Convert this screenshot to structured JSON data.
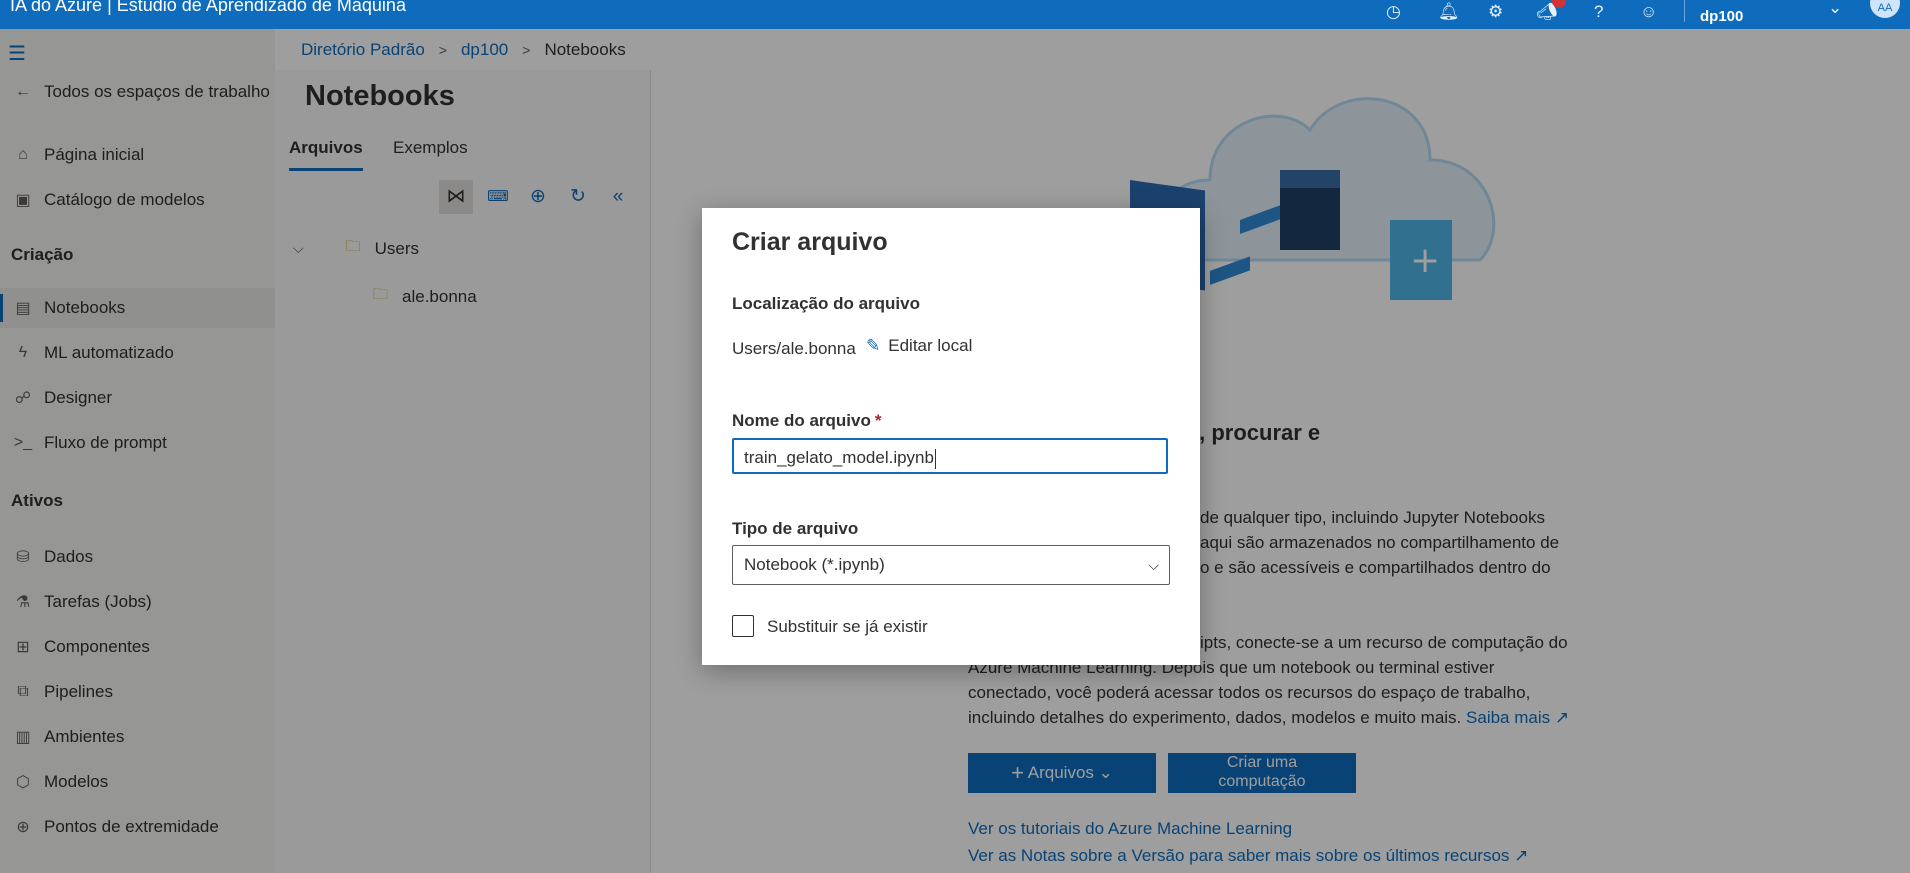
{
  "app": {
    "title": "IA do Azure | Estúdio de Aprendizado de Máquina",
    "account": "dp100",
    "avatar": "AA"
  },
  "breadcrumb": [
    "Diretório Padrão",
    "dp100",
    "Notebooks"
  ],
  "sidebar": {
    "back_label": "Todos os espaços de trabalho",
    "items_top": [
      {
        "label": "Página inicial",
        "icon": "home-icon"
      },
      {
        "label": "Catálogo de modelos",
        "icon": "catalog-icon"
      }
    ],
    "section_authoring": "Criação",
    "items_authoring": [
      {
        "label": "Notebooks",
        "icon": "notebook-icon",
        "active": true
      },
      {
        "label": "ML automatizado",
        "icon": "lightning-icon"
      },
      {
        "label": "Designer",
        "icon": "designer-icon"
      },
      {
        "label": "Fluxo de prompt",
        "icon": "prompt-icon"
      }
    ],
    "section_assets": "Ativos",
    "items_assets": [
      {
        "label": "Dados",
        "icon": "data-icon"
      },
      {
        "label": "Tarefas (Jobs)",
        "icon": "flask-icon"
      },
      {
        "label": "Componentes",
        "icon": "components-icon"
      },
      {
        "label": "Pipelines",
        "icon": "pipelines-icon"
      },
      {
        "label": "Ambientes",
        "icon": "environments-icon"
      },
      {
        "label": "Modelos",
        "icon": "models-icon"
      },
      {
        "label": "Pontos de extremidade",
        "icon": "endpoints-icon"
      }
    ]
  },
  "notebooks": {
    "title": "Notebooks",
    "tabs": [
      "Arquivos",
      "Exemplos"
    ],
    "tree": {
      "root": "Users",
      "child": "ale.bonna"
    }
  },
  "main": {
    "heading": "espaço para adicionar, procurar e",
    "para1": [
      "de qualquer tipo, incluindo Jupyter Notebooks",
      "aqui são armazenados no compartilhamento de",
      "o e são acessíveis e compartilhados dentro do"
    ],
    "para2": [
      "ipts, conecte-se a um recurso de computação do",
      "Azure Machine Learning. Depois que um notebook ou terminal estiver",
      "conectado, você poderá acessar todos os recursos do espaço de trabalho,",
      "incluindo detalhes do experimento, dados, modelos e muito mais."
    ],
    "learn_more": "Saiba mais",
    "files_button": "Arquivos",
    "compute_button_line1": "Criar uma",
    "compute_button_line2": "computação",
    "link_tutorials": "Ver os tutoriais do Azure Machine Learning",
    "link_release_notes": "Ver as Notas sobre a Versão para saber mais sobre os últimos recursos"
  },
  "dialog": {
    "title": "Criar arquivo",
    "location_label": "Localização do arquivo",
    "location_value": "Users/ale.bonna",
    "edit_location": "Editar local",
    "name_label": "Nome do arquivo",
    "name_required": "*",
    "name_value": "train_gelato_model.ipynb",
    "type_label": "Tipo de arquivo",
    "type_value": "Notebook (*.ipynb)",
    "overwrite_label": "Substituir se já existir"
  }
}
